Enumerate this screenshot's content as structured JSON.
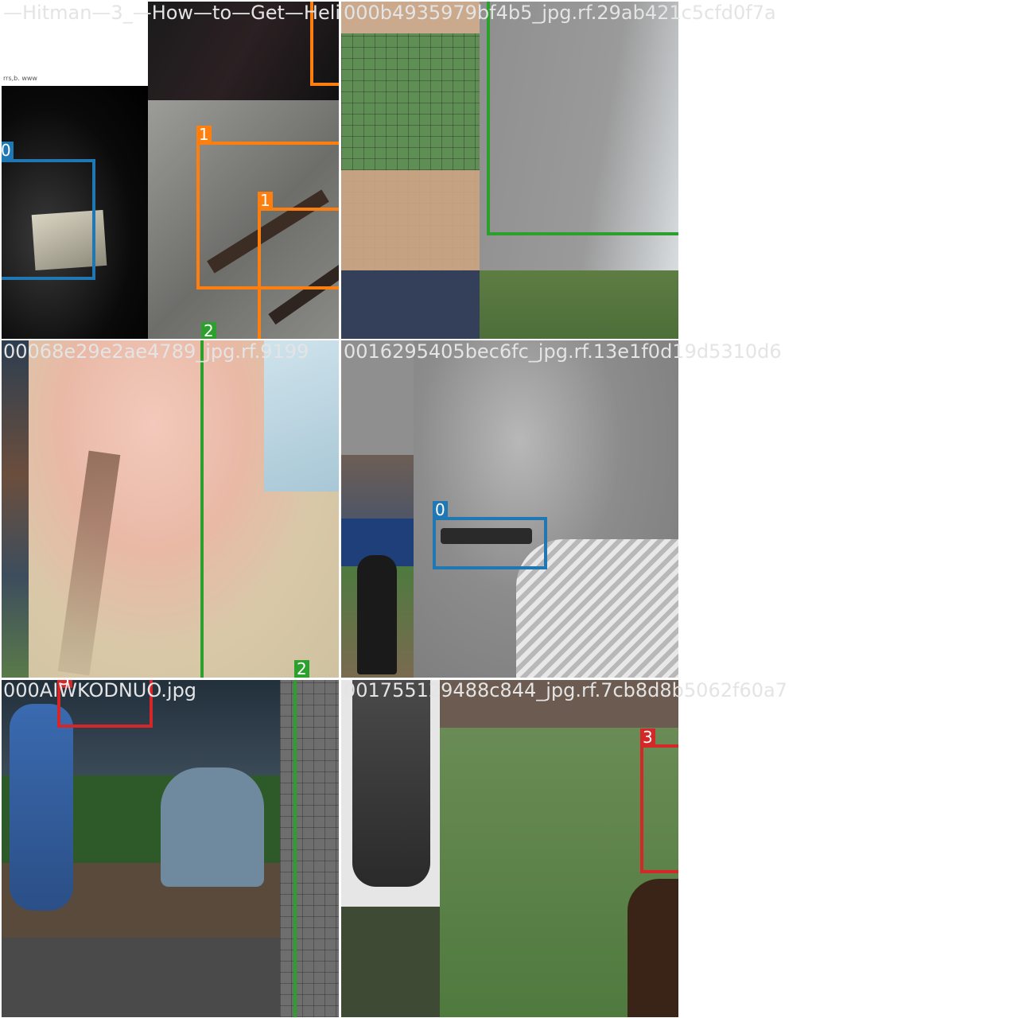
{
  "mosaic": {
    "filenames": [
      "—Hitman—3_—How—to—Get—Heli",
      "000b4935979bf4b5_jpg.rf.29ab421c5cfd0f7a",
      "00068e29e2ae4789_jpg.rf.9199",
      "0016295405bec6fc_jpg.rf.13e1f0d19d5310d6",
      "000AIWKODNUO.jpg",
      "0017551​29488c844_jpg.rf.7cb8d8b5062f60a7"
    ],
    "small_caption": "rrs,b. www"
  },
  "class_labels": {
    "c0": "0",
    "c1": "1",
    "c2": "2",
    "c3": "3"
  },
  "colors": {
    "class0": "#1f77b4",
    "class1": "#ff7f0e",
    "class2": "#2ca02c",
    "class3": "#d62728",
    "filename_text": "#e4e4e4"
  }
}
